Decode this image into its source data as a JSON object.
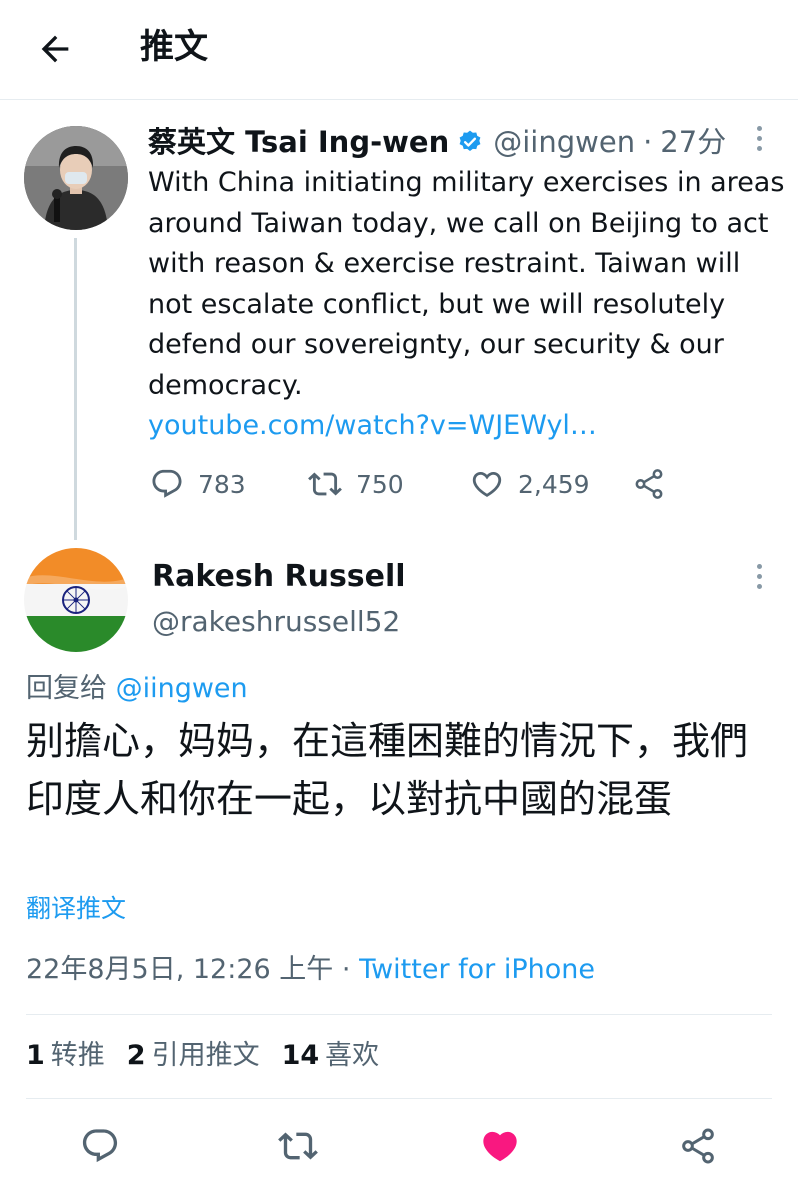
{
  "header": {
    "title": "推文"
  },
  "parent_tweet": {
    "name": "蔡英文 Tsai Ing-wen",
    "handle": "@iingwen",
    "separator": "·",
    "time": "27分",
    "text": "With China initiating military exercises in areas around Taiwan today, we call on Beijing to act with reason & exercise restraint. Taiwan will not escalate conflict, but we will resolutely defend our sovereignty, our security & our democracy.",
    "link": "youtube.com/watch?v=WJEWyl…",
    "replies": "783",
    "retweets": "750",
    "likes": "2,459"
  },
  "reply_tweet": {
    "name": "Rakesh Russell",
    "handle": "@rakeshrussell52",
    "reply_prefix": "回复给",
    "reply_mention": "@iingwen",
    "text": "别擔心，妈妈，在這種困難的情況下，我們印度人和你在一起，以對抗中國的混蛋",
    "translate_label": "翻译推文",
    "timestamp": "22年8月5日, 12:26 上午",
    "separator": "·",
    "source": "Twitter for iPhone",
    "stats": [
      {
        "num": "1",
        "label": "转推"
      },
      {
        "num": "2",
        "label": "引用推文"
      },
      {
        "num": "14",
        "label": "喜欢"
      }
    ]
  },
  "colors": {
    "accent": "#1d9bf0",
    "like_active": "#f91880",
    "muted": "#536471",
    "divider": "#e6ecf0"
  },
  "icons": {
    "back": "arrow-left-icon",
    "verified": "verified-badge-icon",
    "more": "more-vertical-icon",
    "reply": "reply-icon",
    "retweet": "retweet-icon",
    "like": "heart-icon",
    "share": "share-icon"
  }
}
